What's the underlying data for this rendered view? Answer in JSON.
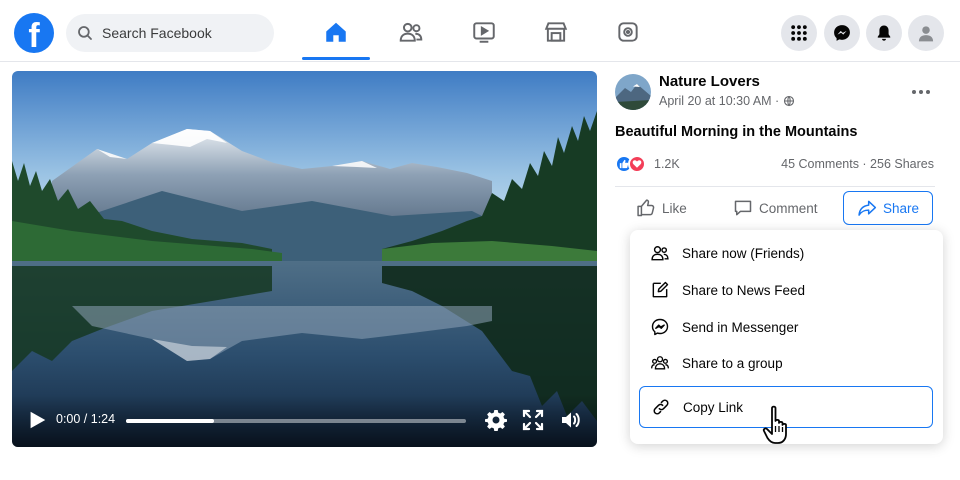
{
  "topbar": {
    "logo_letter": "f",
    "search_placeholder": "Search Facebook",
    "tabs": [
      {
        "name": "home",
        "icon": "home-icon",
        "active": true
      },
      {
        "name": "friends",
        "icon": "friends-icon",
        "active": false
      },
      {
        "name": "watch",
        "icon": "watch-icon",
        "active": false
      },
      {
        "name": "marketplace",
        "icon": "marketplace-icon",
        "active": false
      },
      {
        "name": "gaming",
        "icon": "gaming-icon",
        "active": false
      }
    ],
    "right_buttons": [
      "menu-grid-icon",
      "messenger-icon",
      "bell-icon",
      "profile-avatar"
    ]
  },
  "video": {
    "time": "0:00 / 1:24",
    "progress_fraction": 0.26,
    "controls": [
      "play-icon",
      "settings-icon",
      "fullscreen-icon",
      "volume-icon"
    ]
  },
  "post": {
    "page_name": "Nature Lovers",
    "date": "April 20 at 10:30 AM ·",
    "audience_icon": "globe-icon",
    "title": "Beautiful Morning in the Mountains",
    "reaction_count": "1.2K",
    "stats": "45 Comments · 256 Shares",
    "actions": {
      "like": "Like",
      "comment": "Comment",
      "share": "Share"
    }
  },
  "share_menu": {
    "items": [
      {
        "label": "Share now (Friends)",
        "icon": "share-friends-icon"
      },
      {
        "label": "Share to News Feed",
        "icon": "edit-icon"
      },
      {
        "label": "Send in Messenger",
        "icon": "messenger-icon"
      },
      {
        "label": "Share to a group",
        "icon": "group-icon"
      },
      {
        "label": "Copy Link",
        "icon": "link-icon",
        "selected": true
      }
    ]
  },
  "colors": {
    "brand": "#1877f2",
    "secondary_text": "#65676b",
    "like_blue": "#1877f2",
    "love_red": "#f33e58"
  }
}
